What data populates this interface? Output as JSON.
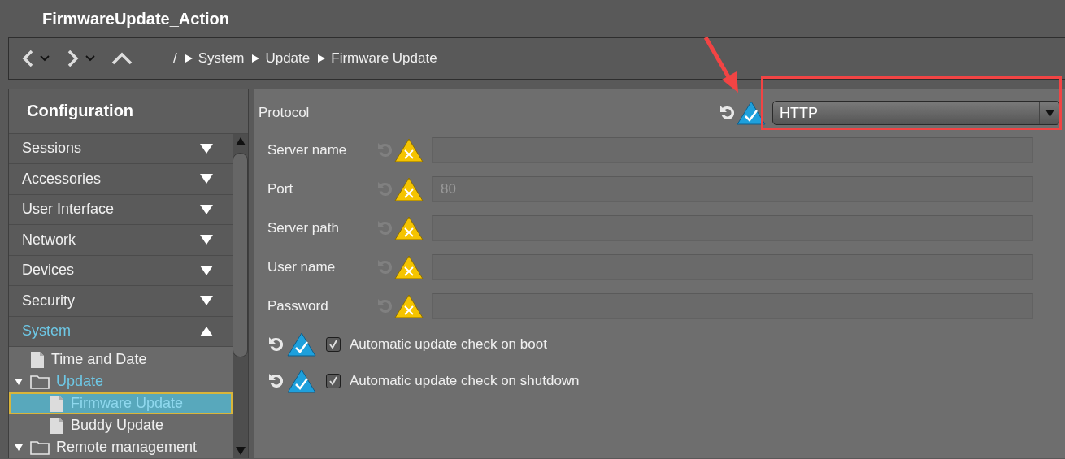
{
  "window": {
    "title": "FirmwareUpdate_Action"
  },
  "breadcrumb": {
    "root": "/",
    "items": [
      "System",
      "Update",
      "Firmware Update"
    ]
  },
  "sidebar": {
    "title": "Configuration",
    "sections": [
      {
        "label": "Sessions",
        "expanded": false
      },
      {
        "label": "Accessories",
        "expanded": false
      },
      {
        "label": "User Interface",
        "expanded": false
      },
      {
        "label": "Network",
        "expanded": false
      },
      {
        "label": "Devices",
        "expanded": false
      },
      {
        "label": "Security",
        "expanded": false
      },
      {
        "label": "System",
        "expanded": true,
        "children": [
          {
            "label": "Time and Date",
            "kind": "page",
            "selected": false
          },
          {
            "label": "Update",
            "kind": "folder",
            "expanded": true,
            "selected": false,
            "children": [
              {
                "label": "Firmware Update",
                "kind": "page",
                "selected": true
              },
              {
                "label": "Buddy Update",
                "kind": "page",
                "selected": false
              }
            ]
          },
          {
            "label": "Remote management",
            "kind": "folder",
            "expanded": true,
            "selected": false
          }
        ]
      }
    ]
  },
  "protocol": {
    "label": "Protocol",
    "valid": true,
    "value": "HTTP"
  },
  "fields": [
    {
      "label": "Server name",
      "valid": false,
      "disabled": true
    },
    {
      "label": "Port",
      "valid": false,
      "disabled": true,
      "value": "80"
    },
    {
      "label": "Server path",
      "valid": false,
      "disabled": true
    },
    {
      "label": "User name",
      "valid": false,
      "disabled": true
    },
    {
      "label": "Password",
      "valid": false,
      "disabled": true
    }
  ],
  "options": [
    {
      "label": "Automatic update check on boot",
      "valid": true,
      "checked": true
    },
    {
      "label": "Automatic update check on shutdown",
      "valid": true,
      "checked": true
    }
  ]
}
